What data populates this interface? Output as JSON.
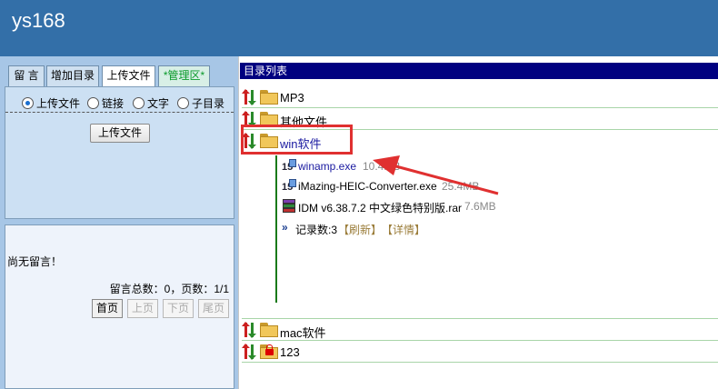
{
  "app": {
    "title": "ys168"
  },
  "tabs": [
    {
      "label": "留 言"
    },
    {
      "label": "增加目录"
    },
    {
      "label": "上传文件"
    },
    {
      "label": "*管理区*"
    }
  ],
  "upload": {
    "options": [
      "上传文件",
      "链接",
      "文字",
      "子目录"
    ],
    "selected": "上传文件",
    "button_label": "上传文件"
  },
  "messages": {
    "empty_text": "尚无留言！",
    "stats": "留言总数：0，页数：1/1",
    "pager": [
      "首页",
      "上页",
      "下页",
      "尾页"
    ]
  },
  "directory": {
    "header": "目录列表",
    "folders": [
      {
        "name": "MP3"
      },
      {
        "name": "其他文件"
      },
      {
        "name": "win软件"
      },
      {
        "name": "mac软件"
      },
      {
        "name": "123",
        "locked": true
      }
    ],
    "files": [
      {
        "name": "winamp.exe",
        "size": "10.4MB",
        "icon": "exe-icon"
      },
      {
        "name": "iMazing-HEIC-Converter.exe",
        "size": "25.4MB",
        "icon": "exe-icon"
      },
      {
        "name": "IDM v6.38.7.2 中文绿色特别版.rar",
        "size": "7.6MB",
        "icon": "rar-archive-icon"
      }
    ],
    "records": {
      "count_text": "记录数:3",
      "refresh": "【刷新】",
      "details": "【详情】"
    }
  },
  "colors": {
    "header_bg": "#336fa8",
    "left_bg": "#a7c6e6",
    "dir_header_bg": "#000080",
    "annotation": "#e03030"
  }
}
